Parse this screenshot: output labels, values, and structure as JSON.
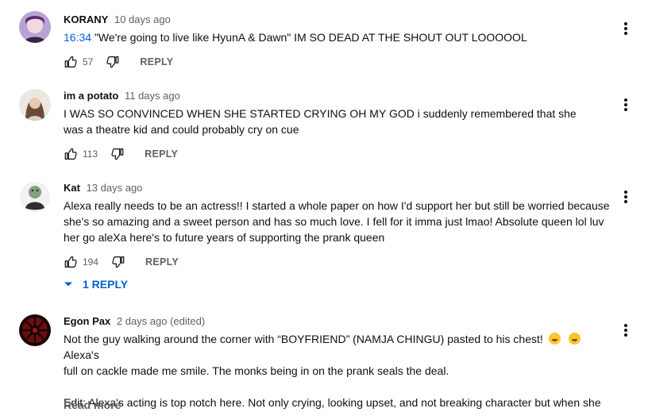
{
  "comments": [
    {
      "author": "KORANY",
      "time": "10 days ago",
      "timestamp_link": "16:34",
      "text": " \"We're going to live like HyunA & Dawn\" IM SO DEAD AT THE SHOUT OUT LOOOOOL",
      "likes": "57",
      "reply_label": "REPLY",
      "avatar_icon": "user-avatar-icon"
    },
    {
      "author": "im a potato",
      "time": "11 days ago",
      "text": "I WAS SO CONVINCED WHEN SHE STARTED CRYING OH MY GOD i suddenly remembered that she was a theatre kid and could probably cry on cue",
      "likes": "113",
      "reply_label": "REPLY",
      "avatar_icon": "user-avatar-icon"
    },
    {
      "author": "Kat",
      "time": "13 days ago",
      "text": "Alexa really needs to be an actress!!  I started a whole paper on how I'd support her but still be worried because she's so amazing and a sweet person and has so much love. I  fell for it imma just lmao! Absolute queen lol luv her go aleXa here's to future years of supporting the prank queen",
      "likes": "194",
      "reply_label": "REPLY",
      "replies_label": "1 REPLY",
      "avatar_icon": "user-avatar-icon"
    },
    {
      "author": "Egon Pax",
      "time": "2 days ago (edited)",
      "text_line1": "Not the guy walking around the corner with “BOYFRIEND” (NAMJA CHINGU) pasted to his chest!",
      "text_line1_end": "Alexa's",
      "text_line2": "full on cackle made me smile. The monks being in on the prank seals the deal.",
      "text_line3": "Edit: Alexa's acting is top notch here. Not only crying, looking upset, and not breaking character but when she …",
      "read_more": "Read more",
      "avatar_icon": "user-avatar-icon"
    }
  ],
  "icons": {
    "like": "thumbs-up-icon",
    "dislike": "thumbs-down-icon",
    "menu": "more-vert-icon",
    "expand": "chevron-down-icon",
    "emoji": "rolling-on-floor-laughing-emoji"
  },
  "colors": {
    "link": "#065fd4",
    "secondary_text": "#606060",
    "primary_text": "#0f0f0f"
  }
}
